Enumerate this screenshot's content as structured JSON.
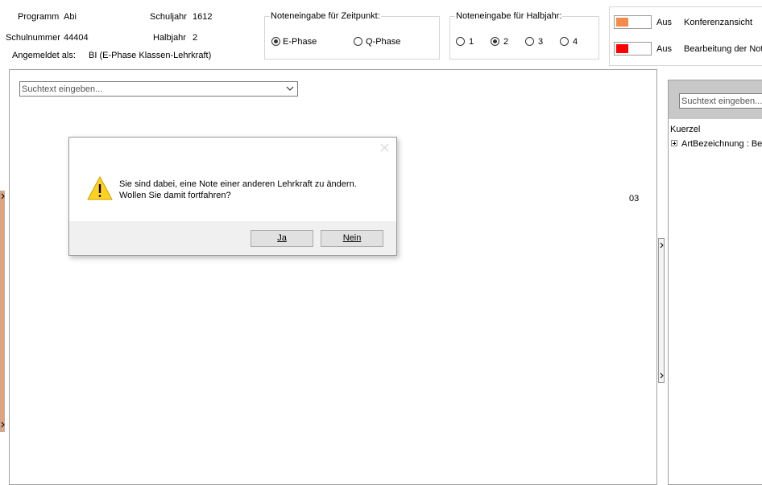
{
  "header": {
    "programm_label": "Programm",
    "programm_value": "Abi",
    "schulnummer_label": "Schulnummer",
    "schulnummer_value": "44404",
    "angemeldet_label": "Angemeldet als:",
    "angemeldet_value": "BI (E-Phase Klassen-Lehrkraft)",
    "schuljahr_label": "Schuljahr",
    "schuljahr_value": "1612",
    "halbjahr_label": "Halbjahr",
    "halbjahr_value": "2"
  },
  "zeitpunkt": {
    "title": "Noteneingabe für Zeitpunkt:",
    "options": [
      "E-Phase",
      "Q-Phase"
    ],
    "selected": "E-Phase"
  },
  "halbjahr_group": {
    "title": "Noteneingabe für Halbjahr:",
    "options": [
      "1",
      "2",
      "3",
      "4"
    ],
    "selected": "2"
  },
  "toggles": [
    {
      "state": "Aus",
      "label": "Konferenzansicht",
      "color": "#f7894a"
    },
    {
      "state": "Aus",
      "label": "Bearbeitung der Not",
      "color": "#ff0000"
    }
  ],
  "main": {
    "search_placeholder": "Suchtext eingeben...",
    "cell_value": "03"
  },
  "right_panel": {
    "search_placeholder": "Suchtext eingeben...",
    "column_header": "Kuerzel",
    "tree_item": "ArtBezeichnung : Ber"
  },
  "dialog": {
    "message_line1": "Sie sind dabei, eine Note einer anderen Lehrkraft zu ändern.",
    "message_line2": "Wollen Sie damit fortfahren?",
    "yes_label": "Ja",
    "no_label": "Nein"
  }
}
